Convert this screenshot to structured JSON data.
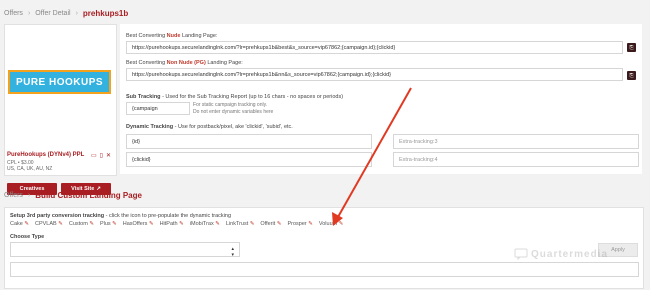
{
  "breadcrumb_top": {
    "root": "Offers",
    "detail": "Offer Detail",
    "current": "prehkups1b"
  },
  "offer": {
    "logo_text": "PURE HOOKUPS",
    "name": "PureHookups (DYNv4) PPL",
    "cpl": "CPL • $3.00",
    "geo": "US, CA, UK, AU, NZ",
    "creatives_label": "Creatives",
    "visit_label": "Visit Site"
  },
  "landing": {
    "nude_label_prefix": "Best Converting",
    "nude_label_highlight": "Nude",
    "nude_label_suffix": "Landing Page:",
    "nude_url": "https://purehookups.securelandinglnk.com/?lr=prehkups1b&best&s_source=vip67862;{campaign.id};{clickid}",
    "nonnude_label_prefix": "Best Converting",
    "nonnude_label_highlight": "Non Nude (PG)",
    "nonnude_label_suffix": "Landing Page:",
    "nonnude_url": "https://purehookups.securelandinglnk.com/?lr=prehkups1b&nn&s_source=vip67862;{campaign.id};{clickid}"
  },
  "sub_tracking": {
    "label_bold": "Sub Tracking",
    "label_rest": " - Used for the Sub Tracking Report (up to 16 chars - no spaces or periods)",
    "value": "{campaign",
    "hint1": "For static campaign tracking only.",
    "hint2": "Do not enter dynamic variables here"
  },
  "dynamic_tracking": {
    "label_bold": "Dynamic Tracking",
    "label_rest": " - Use for postback/pixel, ake 'clickid', 'subid', etc.",
    "field1_value": "{id}",
    "field2_value": "{clickid}",
    "field3_placeholder": "Extra-tracking:3",
    "field4_placeholder": "Extra-tracking:4"
  },
  "breadcrumb_bottom": {
    "root": "Offers",
    "current": "Build Custom Landing Page"
  },
  "build": {
    "setup_label_bold": "Setup 3rd party conversion tracking",
    "setup_label_rest": " - click the icon to pre-populate the dynamic tracking",
    "trackers": [
      "Cake",
      "CPVLAB",
      "Custom",
      "Plus",
      "HasOffers",
      "HitPath",
      "iMobiTrax",
      "LinkTrust",
      "Offerit",
      "Prosper",
      "Voluum"
    ],
    "choose_type_label": "Choose Type",
    "apply_label": "Apply"
  },
  "watermark": "Quartermedia"
}
